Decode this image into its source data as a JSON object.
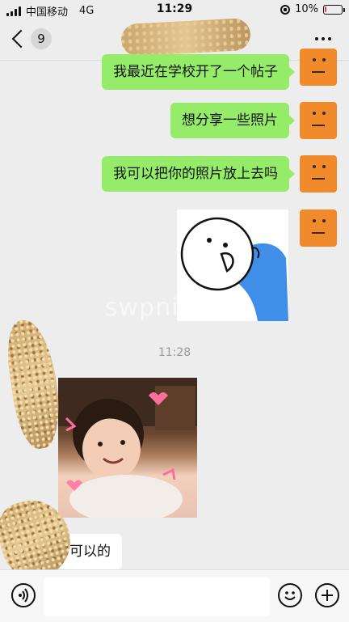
{
  "status_bar": {
    "carrier": "中国移动",
    "network": "4G",
    "time": "11:29",
    "battery_percent": "10%",
    "battery_level": 0.1
  },
  "nav": {
    "unread_count": "9",
    "title": ""
  },
  "messages": [
    {
      "from": "me",
      "text": "我最近在学校开了一个帖子"
    },
    {
      "from": "me",
      "text": "想分享一些照片"
    },
    {
      "from": "me",
      "text": "我可以把你的照片放上去吗"
    },
    {
      "from": "me",
      "type": "sticker"
    },
    {
      "type": "timestamp",
      "text": "11:28"
    },
    {
      "from": "other",
      "type": "photo"
    },
    {
      "from": "other",
      "text": "可以的"
    }
  ],
  "watermark": "swpnia",
  "input": {
    "value": "",
    "placeholder": ""
  },
  "colors": {
    "bubble_me": "#95ec69",
    "bubble_other": "#ffffff",
    "background": "#ededed",
    "avatar_me": "#f08a2a"
  }
}
